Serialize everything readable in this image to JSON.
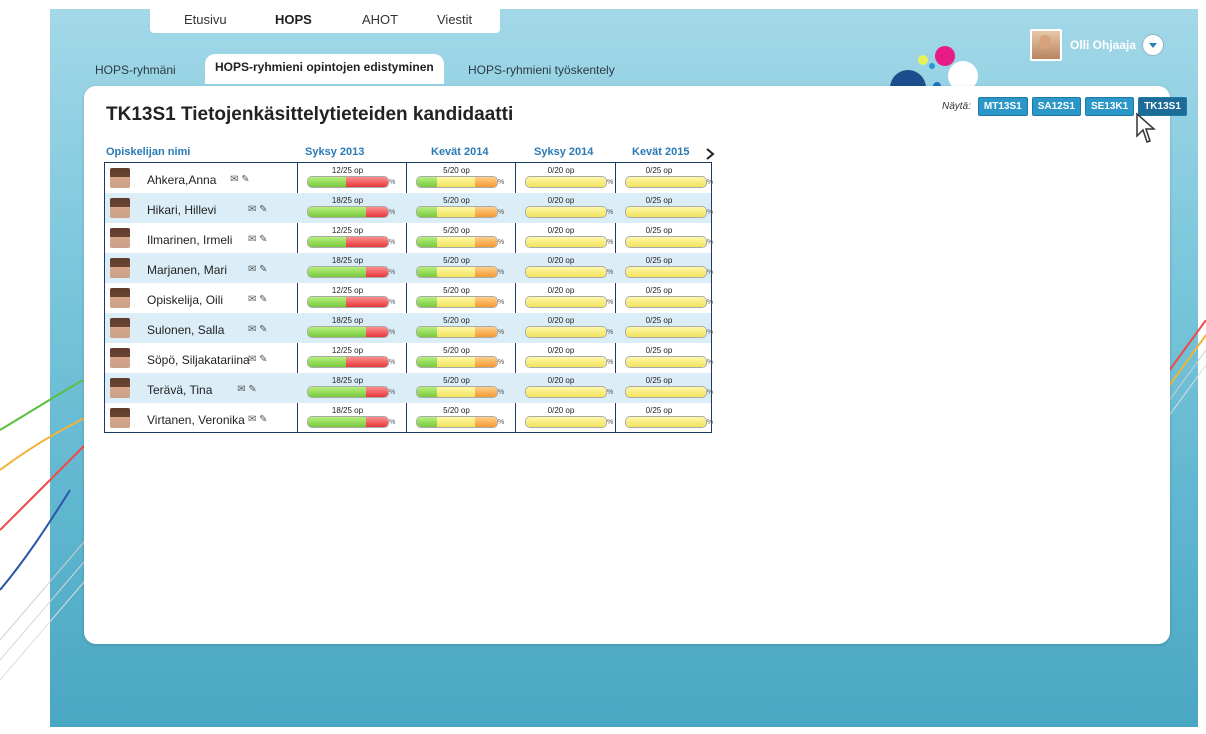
{
  "nav": {
    "top_tabs": [
      "Etusivu",
      "HOPS",
      "AHOT",
      "Viestit"
    ],
    "sub_tabs": [
      "HOPS-ryhmäni",
      "HOPS-ryhmieni opintojen edistyminen",
      "HOPS-ryhmieni työskentely"
    ]
  },
  "user": {
    "name": "Olli Ohjaaja"
  },
  "page": {
    "title": "TK13S1 Tietojenkäsittelytieteiden kandidaatti"
  },
  "filters": {
    "label": "Näytä:",
    "groups": [
      "MT13S1",
      "SA12S1",
      "SE13K1",
      "TK13S1"
    ],
    "selected": "TK13S1"
  },
  "table": {
    "headers": [
      "Opiskelijan nimi",
      "Syksy 2013",
      "Kevät 2014",
      "Syksy 2014",
      "Kevät 2015"
    ],
    "rows": [
      {
        "name": "Ahkera,Anna",
        "cells": [
          "12/25 op",
          "5/20 op",
          "0/20 op",
          "0/25 op"
        ]
      },
      {
        "name": "Hikari, Hillevi",
        "cells": [
          "18/25 op",
          "5/20 op",
          "0/20 op",
          "0/25 op"
        ]
      },
      {
        "name": "Ilmarinen, Irmeli",
        "cells": [
          "12/25 op",
          "5/20 op",
          "0/20 op",
          "0/25 op"
        ]
      },
      {
        "name": "Marjanen, Mari",
        "cells": [
          "18/25 op",
          "5/20 op",
          "0/20 op",
          "0/25 op"
        ]
      },
      {
        "name": "Opiskelija, Oili",
        "cells": [
          "12/25 op",
          "5/20 op",
          "0/20 op",
          "0/25 op"
        ]
      },
      {
        "name": "Sulonen, Salla",
        "cells": [
          "18/25 op",
          "5/20 op",
          "0/20 op",
          "0/25 op"
        ]
      },
      {
        "name": "Söpö, Siljakatariina",
        "cells": [
          "12/25 op",
          "5/20 op",
          "0/20 op",
          "0/25 op"
        ]
      },
      {
        "name": "Terävä, Tina",
        "cells": [
          "18/25 op",
          "5/20 op",
          "0/20 op",
          "0/25 op"
        ]
      },
      {
        "name": "Virtanen, Veronika",
        "cells": [
          "18/25 op",
          "5/20 op",
          "0/20 op",
          "0/25 op"
        ]
      }
    ],
    "pct_symbol": "%"
  },
  "icons": {
    "mail": "mail-icon",
    "edit": "pencil-icon",
    "next": "chevron-right-icon",
    "user_menu": "chevron-down-icon"
  },
  "colors": {
    "accent": "#2b97c9",
    "selected_group": "#1d6b97",
    "header_blue": "#2a7ab6",
    "progress_green": "#79c93e",
    "progress_red": "#e5383b",
    "progress_yellow": "#f1e35d",
    "progress_orange": "#f49a33"
  }
}
